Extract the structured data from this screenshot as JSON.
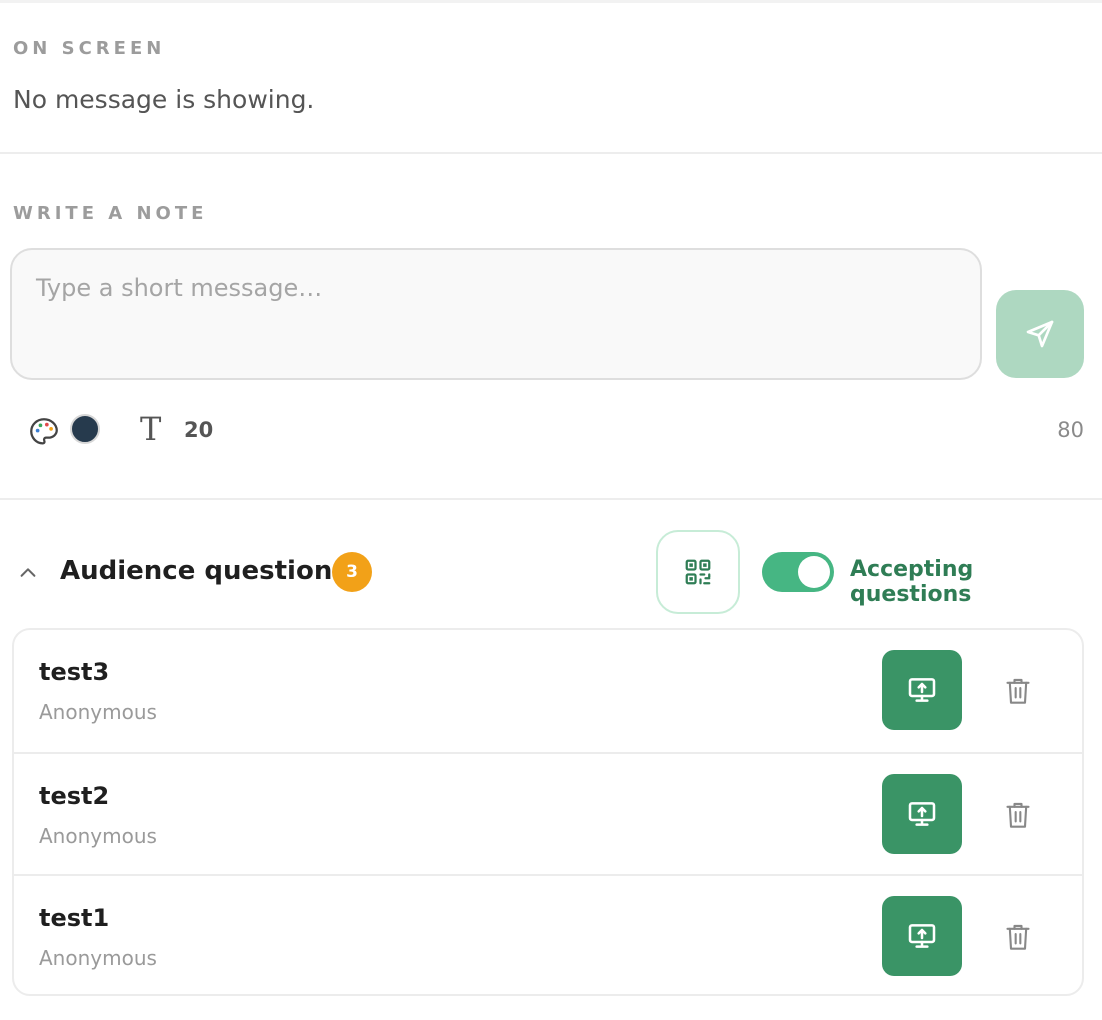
{
  "on_screen": {
    "label": "ON SCREEN",
    "text": "No message is showing."
  },
  "note": {
    "label": "WRITE A NOTE",
    "placeholder": "Type a short message…",
    "value": "",
    "send_icon": "send-icon",
    "palette_icon": "palette-icon",
    "text_color": "#263a4d",
    "text_icon_glyph": "T",
    "font_size": "20",
    "char_limit": "80"
  },
  "audience": {
    "title": "Audience questions",
    "count": "3",
    "qr_icon": "qr-code-icon",
    "accepting_on": true,
    "accepting_label": "Accepting questions",
    "accent": "#3a9466",
    "badge_color": "#f2a118",
    "questions": [
      {
        "text": "test3",
        "author": "Anonymous"
      },
      {
        "text": "test2",
        "author": "Anonymous"
      },
      {
        "text": "test1",
        "author": "Anonymous"
      }
    ]
  }
}
